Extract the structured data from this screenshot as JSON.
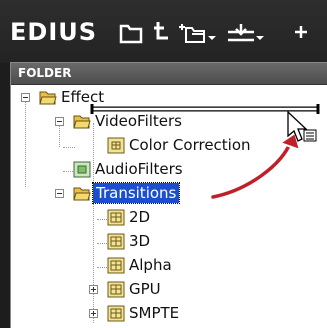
{
  "app": {
    "title": "EDIUS"
  },
  "toolbar": {
    "icons": [
      "folder-icon",
      "up-folder-icon",
      "new-folder-icon",
      "import-icon",
      "more-icon"
    ]
  },
  "panel": {
    "header": "FOLDER"
  },
  "tree": {
    "effect": "Effect",
    "video_filters": "VideoFilters",
    "color_correction": "Color Correction",
    "audio_filters": "AudioFilters",
    "transitions": "Transitions",
    "t_2d": "2D",
    "t_3d": "3D",
    "t_alpha": "Alpha",
    "t_gpu": "GPU",
    "t_smpte": "SMPTE"
  },
  "colors": {
    "selection": "#1b4fcf",
    "arrow": "#c0202a",
    "drop_marker": "#ffffff"
  }
}
